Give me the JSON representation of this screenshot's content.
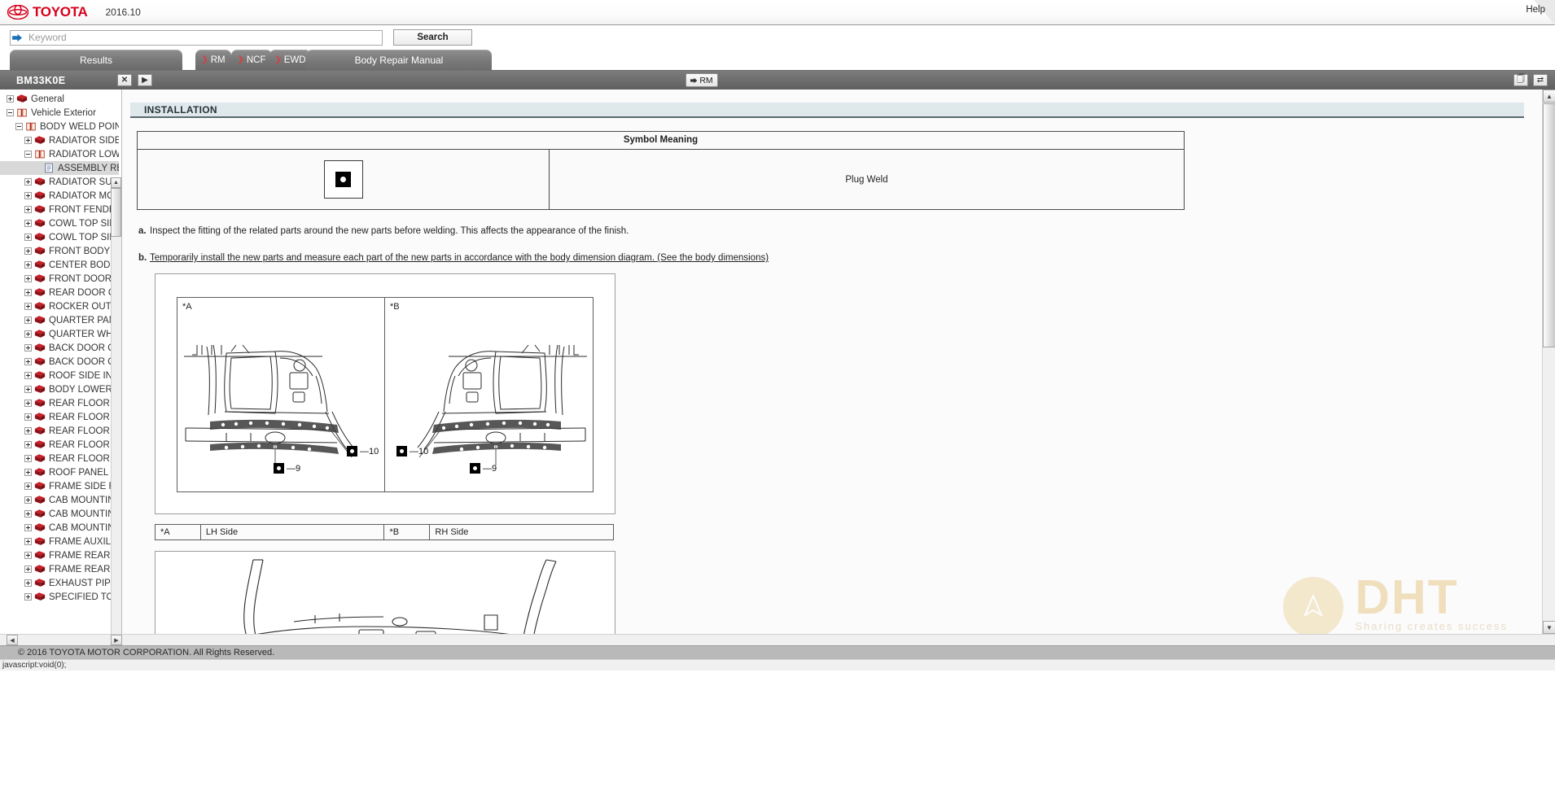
{
  "brand": {
    "name": "TOYOTA",
    "version": "2016.10",
    "help_label": "Help",
    "logo_icon": "toyota-ellipse-logo",
    "accent_color": "#d6001c"
  },
  "search": {
    "placeholder": "Keyword",
    "value": "",
    "arrow_icon": "arrow-right-icon",
    "button_label": "Search"
  },
  "tabs": [
    {
      "label": "Results",
      "icon": "",
      "name": "results"
    },
    {
      "label": "RM",
      "icon": "chevron-right-icon",
      "name": "rm"
    },
    {
      "label": "NCF",
      "icon": "chevron-right-icon",
      "name": "ncf"
    },
    {
      "label": "EWD",
      "icon": "chevron-right-icon",
      "name": "ewd"
    },
    {
      "label": "Body Repair Manual",
      "icon": "",
      "name": "body-repair-manual"
    }
  ],
  "document_header": {
    "doc_id": "BM33K0E",
    "close_label": "✕",
    "next_label": "▶",
    "rm_button_label": "RM",
    "rm_button_icon": "arrow-right-icon",
    "window_buttons": [
      "restore-window-icon",
      "maximize-window-icon"
    ]
  },
  "sidebar": {
    "scroll_up_icon": "triangle-up-icon",
    "scroll_down_icon": "triangle-down-icon",
    "items": [
      {
        "label": "General",
        "depth": 0,
        "state": "plus",
        "icon": "book-closed-icon",
        "selected": false
      },
      {
        "label": "Vehicle Exterior",
        "depth": 0,
        "state": "minus",
        "icon": "book-open-icon",
        "selected": false
      },
      {
        "label": "BODY WELD POINT",
        "depth": 1,
        "state": "minus",
        "icon": "book-open-icon",
        "selected": false
      },
      {
        "label": "RADIATOR SIDE S",
        "depth": 2,
        "state": "plus",
        "icon": "book-closed-icon",
        "selected": false
      },
      {
        "label": "RADIATOR LOWER",
        "depth": 2,
        "state": "minus",
        "icon": "book-open-icon",
        "selected": false
      },
      {
        "label": "ASSEMBLY REPLA",
        "depth": 3,
        "state": "none",
        "icon": "document-icon",
        "selected": true
      },
      {
        "label": "RADIATOR SUPPO",
        "depth": 2,
        "state": "plus",
        "icon": "book-closed-icon",
        "selected": false
      },
      {
        "label": "RADIATOR MOUNT",
        "depth": 2,
        "state": "plus",
        "icon": "book-closed-icon",
        "selected": false
      },
      {
        "label": "FRONT FENDER A",
        "depth": 2,
        "state": "plus",
        "icon": "book-closed-icon",
        "selected": false
      },
      {
        "label": "COWL TOP SIDE U",
        "depth": 2,
        "state": "plus",
        "icon": "book-closed-icon",
        "selected": false
      },
      {
        "label": "COWL TOP SIDE F",
        "depth": 2,
        "state": "plus",
        "icon": "book-closed-icon",
        "selected": false
      },
      {
        "label": "FRONT BODY PILL",
        "depth": 2,
        "state": "plus",
        "icon": "book-closed-icon",
        "selected": false
      },
      {
        "label": "CENTER BODY PIL",
        "depth": 2,
        "state": "plus",
        "icon": "book-closed-icon",
        "selected": false
      },
      {
        "label": "FRONT DOOR OUT",
        "depth": 2,
        "state": "plus",
        "icon": "book-closed-icon",
        "selected": false
      },
      {
        "label": "REAR DOOR OUTE",
        "depth": 2,
        "state": "plus",
        "icon": "book-closed-icon",
        "selected": false
      },
      {
        "label": "ROCKER OUTER P",
        "depth": 2,
        "state": "plus",
        "icon": "book-closed-icon",
        "selected": false
      },
      {
        "label": "QUARTER PANEL",
        "depth": 2,
        "state": "plus",
        "icon": "book-closed-icon",
        "selected": false
      },
      {
        "label": "QUARTER WHEEL",
        "depth": 2,
        "state": "plus",
        "icon": "book-closed-icon",
        "selected": false
      },
      {
        "label": "BACK DOOR OPEN",
        "depth": 2,
        "state": "plus",
        "icon": "book-closed-icon",
        "selected": false
      },
      {
        "label": "BACK DOOR OPEN",
        "depth": 2,
        "state": "plus",
        "icon": "book-closed-icon",
        "selected": false
      },
      {
        "label": "ROOF SIDE INNER",
        "depth": 2,
        "state": "plus",
        "icon": "book-closed-icon",
        "selected": false
      },
      {
        "label": "BODY LOWER BAC",
        "depth": 2,
        "state": "plus",
        "icon": "book-closed-icon",
        "selected": false
      },
      {
        "label": "REAR FLOOR CRO",
        "depth": 2,
        "state": "plus",
        "icon": "book-closed-icon",
        "selected": false
      },
      {
        "label": "REAR FLOOR PAN",
        "depth": 2,
        "state": "plus",
        "icon": "book-closed-icon",
        "selected": false
      },
      {
        "label": "REAR FLOOR SIDE",
        "depth": 2,
        "state": "plus",
        "icon": "book-closed-icon",
        "selected": false
      },
      {
        "label": "REAR FLOOR SIDE",
        "depth": 2,
        "state": "plus",
        "icon": "book-closed-icon",
        "selected": false
      },
      {
        "label": "REAR FLOOR SIDE",
        "depth": 2,
        "state": "plus",
        "icon": "book-closed-icon",
        "selected": false
      },
      {
        "label": "ROOF PANEL",
        "depth": 2,
        "state": "plus",
        "icon": "book-closed-icon",
        "selected": false
      },
      {
        "label": "FRAME SIDE RAIL",
        "depth": 2,
        "state": "plus",
        "icon": "book-closed-icon",
        "selected": false
      },
      {
        "label": "CAB MOUNTING M",
        "depth": 2,
        "state": "plus",
        "icon": "book-closed-icon",
        "selected": false
      },
      {
        "label": "CAB MOUNTING M",
        "depth": 2,
        "state": "plus",
        "icon": "book-closed-icon",
        "selected": false
      },
      {
        "label": "CAB MOUNTING M",
        "depth": 2,
        "state": "plus",
        "icon": "book-closed-icon",
        "selected": false
      },
      {
        "label": "FRAME AUXILIARY",
        "depth": 2,
        "state": "plus",
        "icon": "book-closed-icon",
        "selected": false
      },
      {
        "label": "FRAME REAR FRO",
        "depth": 2,
        "state": "plus",
        "icon": "book-closed-icon",
        "selected": false
      },
      {
        "label": "FRAME REAR CRO",
        "depth": 2,
        "state": "plus",
        "icon": "book-closed-icon",
        "selected": false
      },
      {
        "label": "EXHAUST PIPE SU",
        "depth": 2,
        "state": "plus",
        "icon": "book-closed-icon",
        "selected": false
      },
      {
        "label": "SPECIFIED TORQU",
        "depth": 2,
        "state": "plus",
        "icon": "book-closed-icon",
        "selected": false
      }
    ]
  },
  "content": {
    "section_title": "INSTALLATION",
    "symbol_table": {
      "header": "Symbol Meaning",
      "symbol_icon": "plug-weld-symbol",
      "meaning": "Plug Weld"
    },
    "steps": [
      {
        "marker": "a.",
        "text": "Inspect the fitting of the related parts around the new parts before welding. This affects the appearance of the finish.",
        "underlined": false
      },
      {
        "marker": "b.",
        "text": "Temporarily install the new parts and measure each part of the new parts in accordance with the body dimension diagram. (See the body dimensions)",
        "underlined": true
      }
    ],
    "figure1": {
      "panes": [
        {
          "tag": "*A",
          "callouts": [
            {
              "icon": "plug-weld-symbol",
              "text": "—10"
            },
            {
              "icon": "plug-weld-symbol",
              "text": "—9"
            }
          ]
        },
        {
          "tag": "*B",
          "callouts": [
            {
              "icon": "plug-weld-symbol",
              "text": "—10"
            },
            {
              "icon": "plug-weld-symbol",
              "text": "—9"
            }
          ]
        }
      ]
    },
    "side_table": [
      {
        "key": "*A",
        "value": "LH Side"
      },
      {
        "key": "*B",
        "value": "RH Side"
      }
    ]
  },
  "watermark": {
    "brand": "DHT",
    "tagline": "Sharing  creates  success",
    "mark_icon": "dht-circle-icon"
  },
  "footer": {
    "copyright": "© 2016 TOYOTA MOTOR CORPORATION. All Rights Reserved."
  },
  "statusbar": {
    "text": "javascript:void(0);"
  },
  "scroll": {
    "left_icon": "triangle-left-icon",
    "right_icon": "triangle-right-icon",
    "up_icon": "triangle-up-icon",
    "down_icon": "triangle-down-icon"
  }
}
